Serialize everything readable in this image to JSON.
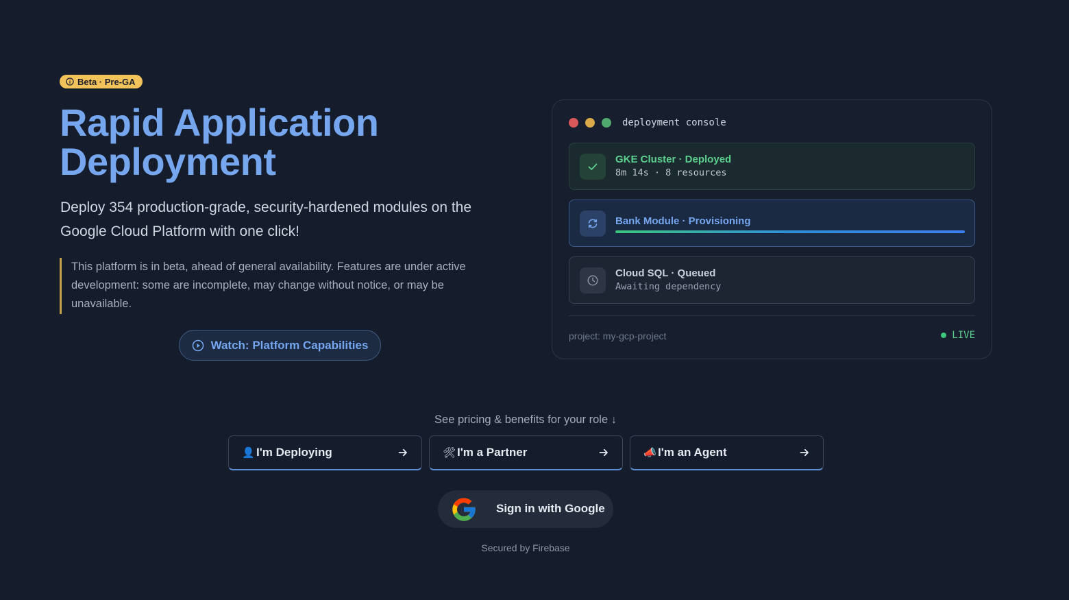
{
  "badge": {
    "label": "Beta · Pre-GA",
    "icon": "info-icon"
  },
  "hero": {
    "title": "Rapid Application Deployment",
    "subtitle": "Deploy 354 production-grade, security-hardened modules on the Google Cloud Platform with one click!",
    "beta_note": "This platform is in beta, ahead of general availability. Features are under active development: some are incomplete, may change without notice, or may be unavailable.",
    "watch_button": "Watch: Platform Capabilities"
  },
  "console": {
    "title": "deployment console",
    "window_dots": [
      "#d9595b",
      "#d9a94a",
      "#4fa96f"
    ],
    "steps": [
      {
        "name": "GKE Cluster · Deployed",
        "detail": "8m 14s · 8 resources",
        "status": "deployed",
        "icon": "check-icon"
      },
      {
        "name": "Bank Module · Provisioning",
        "status": "provisioning",
        "icon": "refresh-icon",
        "progress": 1.0
      },
      {
        "name": "Cloud SQL · Queued",
        "detail": "Awaiting dependency",
        "status": "queued",
        "icon": "clock-icon"
      }
    ],
    "project": "project: my-gcp-project",
    "live": "LIVE"
  },
  "roles": {
    "caption": "See pricing & benefits for your role ↓",
    "items": [
      {
        "emoji": "👤",
        "label": "I'm Deploying"
      },
      {
        "emoji": "🛠",
        "label": "I'm a Partner"
      },
      {
        "emoji": "📣",
        "label": "I'm an Agent"
      }
    ]
  },
  "auth": {
    "google_button": "Sign in with Google",
    "secured_by": "Secured by Firebase"
  },
  "colors": {
    "background": "#151c2c",
    "accent": "#75a6ee",
    "success": "#5ecf8e",
    "badge": "#f2c35a"
  }
}
